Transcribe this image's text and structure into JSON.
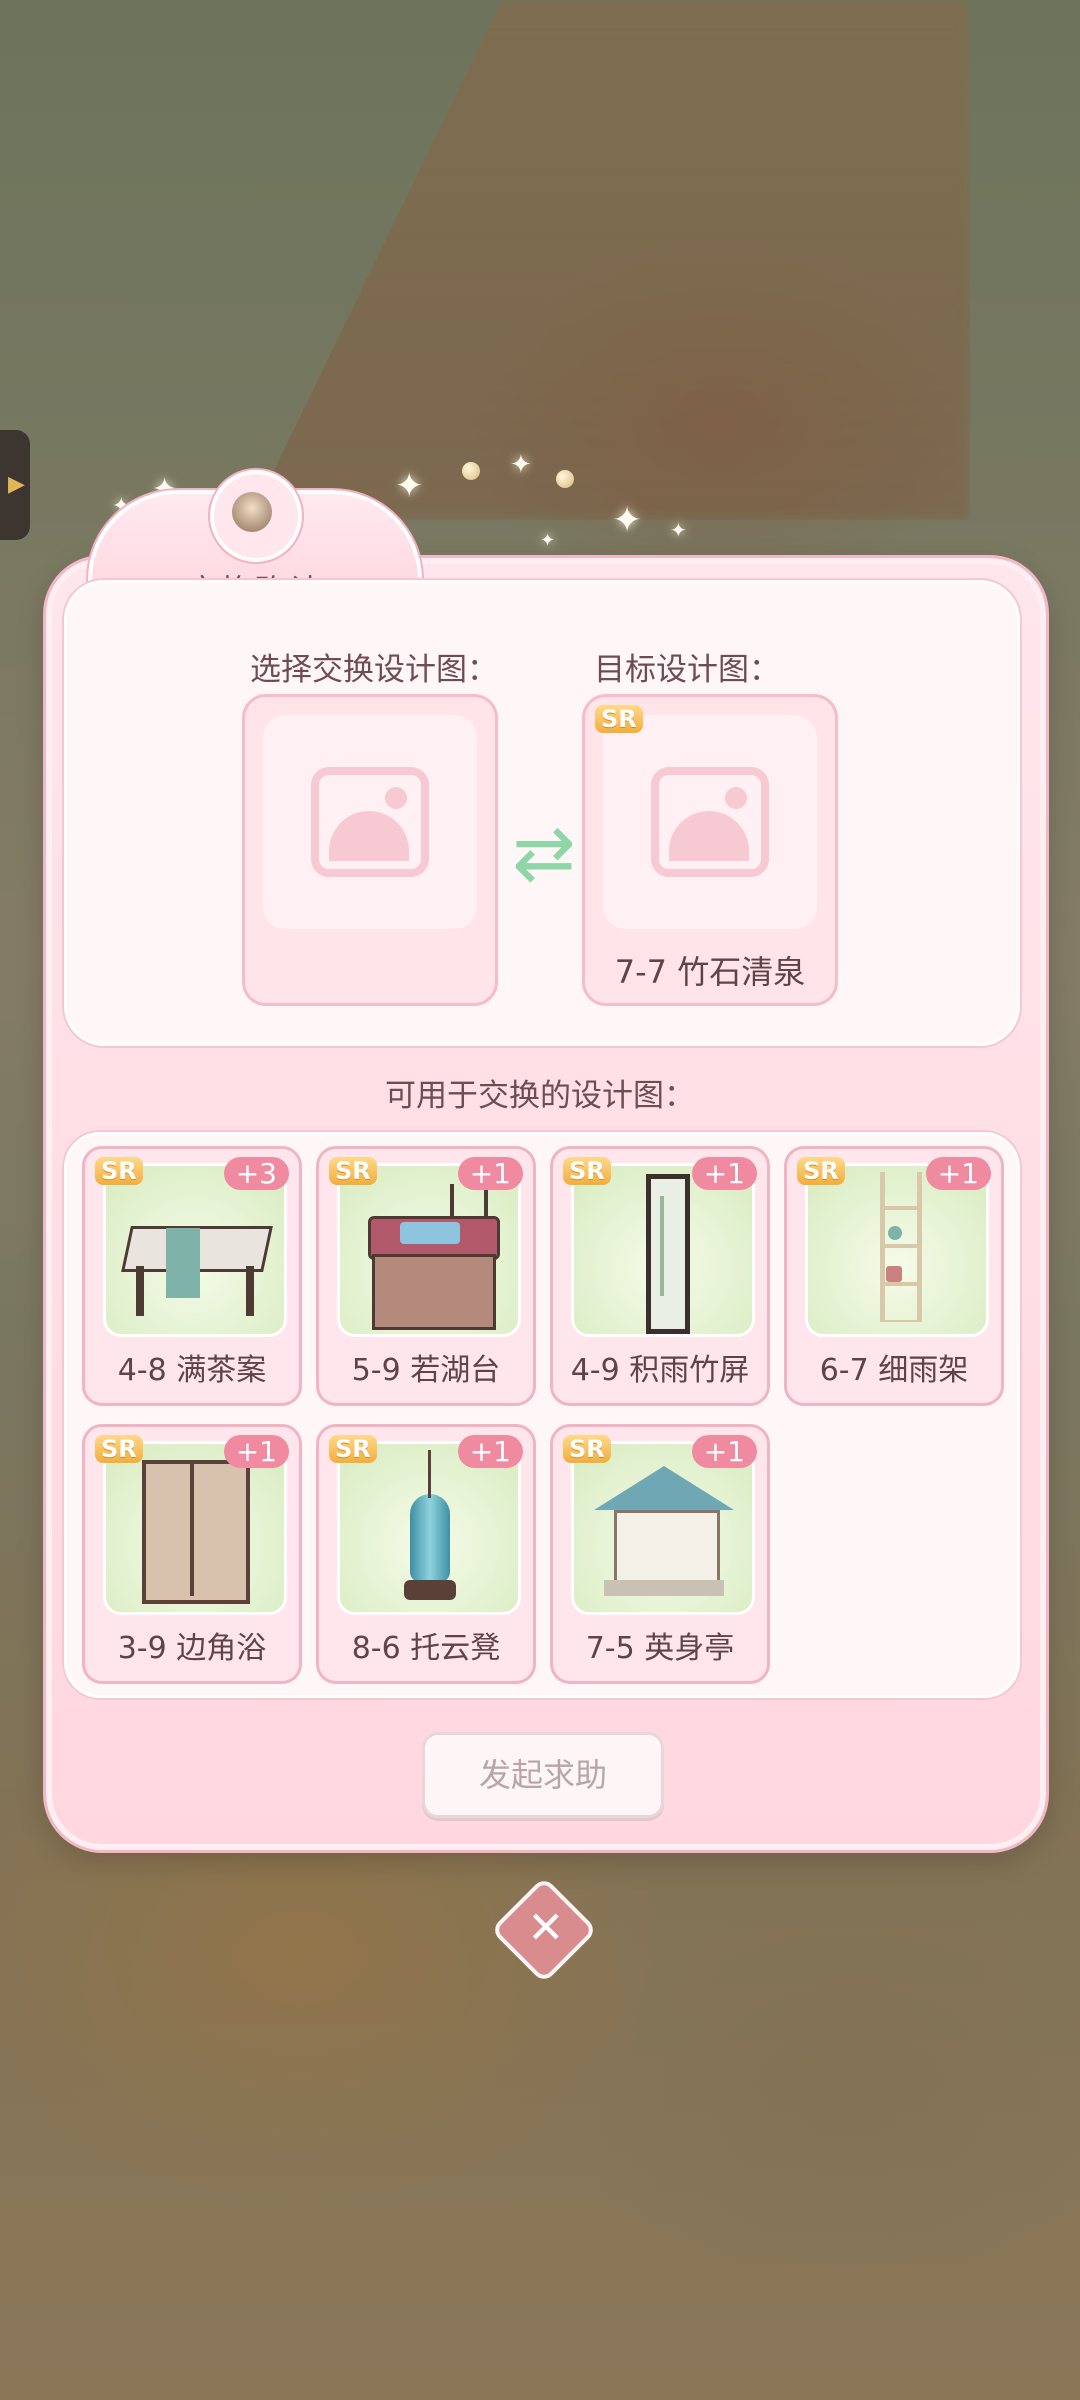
{
  "dialog": {
    "title": "交换确认",
    "select_label": "选择交换设计图：",
    "target_label": "目标设计图：",
    "target_rarity": "SR",
    "target_name": "7-7 竹石清泉",
    "list_title": "可用于交换的设计图：",
    "request_button": "发起求助"
  },
  "items": [
    {
      "rarity": "SR",
      "count": "+3",
      "name": "4-8 满茶案"
    },
    {
      "rarity": "SR",
      "count": "+1",
      "name": "5-9 若湖台"
    },
    {
      "rarity": "SR",
      "count": "+1",
      "name": "4-9 积雨竹屏"
    },
    {
      "rarity": "SR",
      "count": "+1",
      "name": "6-7 细雨架"
    },
    {
      "rarity": "SR",
      "count": "+1",
      "name": "3-9 边角浴"
    },
    {
      "rarity": "SR",
      "count": "+1",
      "name": "8-6 托云凳"
    },
    {
      "rarity": "SR",
      "count": "+1",
      "name": "7-5 英身亭"
    }
  ],
  "icons": {
    "swap": "swap-arrows-icon",
    "close": "close-icon",
    "placeholder": "image-placeholder-icon"
  },
  "colors": {
    "panel": "#ffd7e0",
    "accent": "#f08aa0",
    "rarity": "#f2ad3d",
    "swap": "#8fd6a6"
  }
}
